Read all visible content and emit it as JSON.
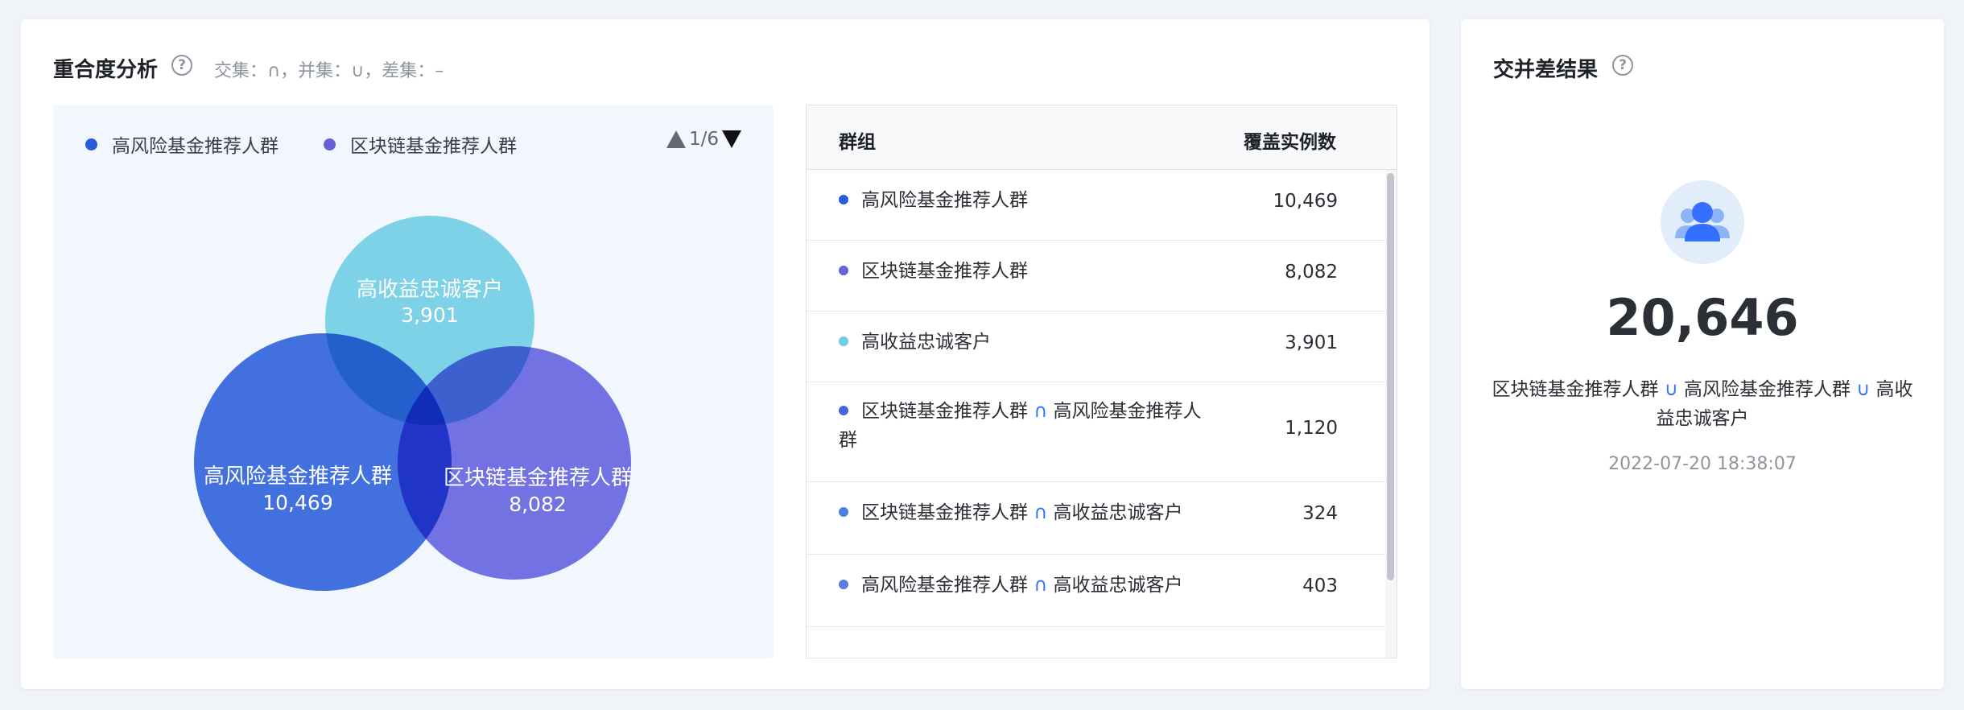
{
  "overlap": {
    "title": "重合度分析",
    "help_icon": "question-circle-icon",
    "hint": "交集：∩，并集：∪，差集：–",
    "legend": [
      {
        "label": "高风险基金推荐人群",
        "color": "#2a5bd7"
      },
      {
        "label": "区块链基金推荐人群",
        "color": "#6760d8"
      }
    ],
    "pager": {
      "text": "1/6",
      "prev_icon": "triangle-up-icon",
      "next_icon": "triangle-down-icon"
    },
    "venn": [
      {
        "name": "高收益忠诚客户",
        "value": "3,901",
        "color": "#6ccde4"
      },
      {
        "name": "高风险基金推荐人群",
        "value": "10,469",
        "color": "#2c61dd"
      },
      {
        "name": "区块链基金推荐人群",
        "value": "8,082",
        "color": "#6a67e2"
      }
    ]
  },
  "table": {
    "headers": {
      "group": "群组",
      "count": "覆盖实例数"
    },
    "rows": [
      {
        "color": "#2a5bd7",
        "parts": [
          "高风险基金推荐人群"
        ],
        "count": "10,469"
      },
      {
        "color": "#6760d8",
        "parts": [
          "区块链基金推荐人群"
        ],
        "count": "8,082"
      },
      {
        "color": "#6ccde4",
        "parts": [
          "高收益忠诚客户"
        ],
        "count": "3,901"
      },
      {
        "color": "#4a63dd",
        "parts": [
          "区块链基金推荐人群",
          "∩",
          "高风险基金推荐人群"
        ],
        "count": "1,120"
      },
      {
        "color": "#4d80e0",
        "parts": [
          "区块链基金推荐人群",
          "∩",
          "高收益忠诚客户"
        ],
        "count": "324"
      },
      {
        "color": "#5a7de0",
        "parts": [
          "高风险基金推荐人群",
          "∩",
          "高收益忠诚客户"
        ],
        "count": "403"
      }
    ]
  },
  "result": {
    "title": "交并差结果",
    "help_icon": "question-circle-icon",
    "icon": "user-group-icon",
    "value": "20,646",
    "expr_parts": [
      "区块链基金推荐人群",
      "∪",
      "高风险基金推荐人群",
      "∪",
      "高收益忠诚客户"
    ],
    "timestamp": "2022-07-20 18:38:07"
  }
}
